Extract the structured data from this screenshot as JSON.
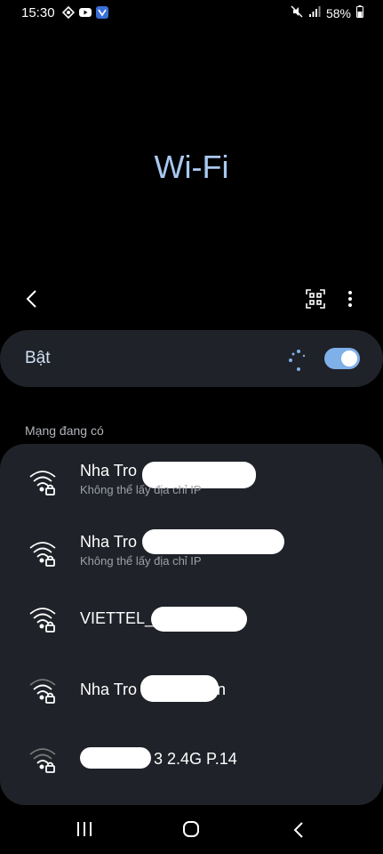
{
  "status_bar": {
    "time": "15:30",
    "battery": "58%",
    "notification_icons": [
      "sync-icon",
      "youtube-icon",
      "app-icon"
    ]
  },
  "page": {
    "title": "Wi-Fi"
  },
  "toolbar": {
    "back_icon": "chevron-left-icon",
    "qr_icon": "qr-scan-icon",
    "more_icon": "more-vert-icon"
  },
  "wifi_toggle": {
    "label": "Bật",
    "state": "on",
    "accent_color": "#7fb0e8"
  },
  "available_networks": {
    "label": "Mạng đang có",
    "items": [
      {
        "name": "Nha Tro",
        "status": "Không thể lấy địa chỉ IP",
        "locked": true
      },
      {
        "name": "Nha Tro",
        "status": "Không thể lấy địa chỉ IP",
        "locked": true
      },
      {
        "name": "VIETTEL_",
        "status": "",
        "locked": true
      },
      {
        "name": "Nha Tro",
        "name_suffix": "n",
        "status": "",
        "locked": true
      },
      {
        "name": "3 2.4G P.14",
        "status": "",
        "locked": true
      }
    ]
  },
  "colors": {
    "background": "#000000",
    "card": "#1f2228",
    "title": "#a8c8f0"
  }
}
